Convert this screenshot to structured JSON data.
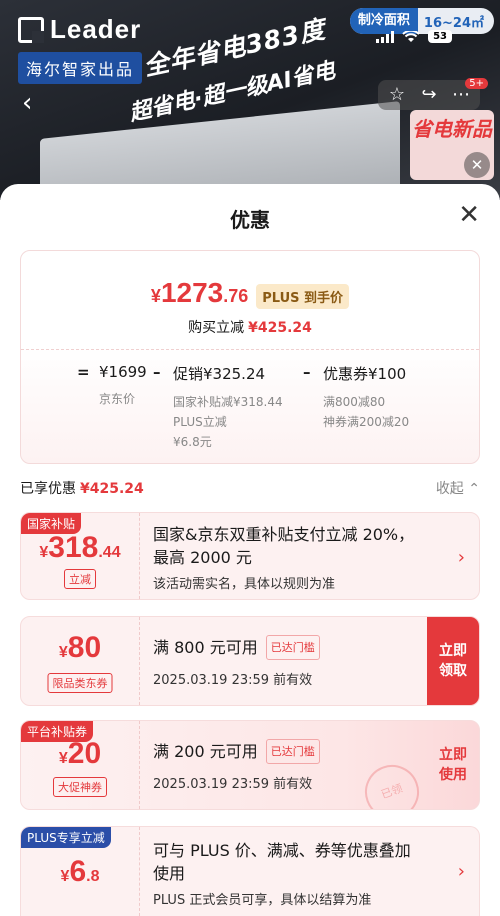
{
  "banner": {
    "logo": "Leader",
    "brand_tag": "海尔智家出品",
    "slogan_line1": "全年省电383度",
    "slogan_line2": "超省电·超一级AI省电",
    "area_chip_label": "制冷面积",
    "area_chip_value": "16~24㎡",
    "battery": "53",
    "new_badge_count": "5+",
    "side_card_text": "省电新品"
  },
  "sheet": {
    "title": "优惠"
  },
  "summary": {
    "currency": "¥",
    "price_int": "1273",
    "price_dec": ".76",
    "plus_tag": "PLUS 到手价",
    "direct_cut_label": "购买立减",
    "direct_cut_amount": "¥425.24",
    "breakdown": {
      "eq": "=",
      "jd_price": "¥1699",
      "jd_price_label": "京东价",
      "minus1": "–",
      "promo": "促销¥325.24",
      "promo_sub1": "国家补贴减¥318.44",
      "promo_sub2": "PLUS立减",
      "promo_sub3": "¥6.8元",
      "minus2": "–",
      "coupon": "优惠券¥100",
      "coupon_sub1": "满800减80",
      "coupon_sub2": "神券满200减20"
    }
  },
  "enjoyed": {
    "label": "已享优惠",
    "amount": "¥425.24",
    "collapse": "收起"
  },
  "cards": [
    {
      "tag": "国家补贴",
      "tag_color": "#e4393c",
      "cur": "¥",
      "int": "318",
      "dec": ".44",
      "sub": "立减",
      "title": "国家&京东双重补贴支付立减 20%，",
      "title2": "最高 2000 元",
      "desc": "该活动需实名，具体以规则为准"
    },
    {
      "cur": "¥",
      "int": "80",
      "sub": "限品类东券",
      "title": "满 800 元可用",
      "threshold": "已达门槛",
      "desc": "2025.03.19 23:59 前有效",
      "action": "立即领取",
      "action1": "立即",
      "action2": "领取",
      "action_bg": "#e4393c"
    },
    {
      "tag": "平台补贴券",
      "tag_color": "#e4393c",
      "cur": "¥",
      "int": "20",
      "sub": "大促神券",
      "title": "满 200 元可用",
      "threshold": "已达门槛",
      "desc": "2025.03.19 23:59 前有效",
      "action1": "立即",
      "action2": "使用",
      "stamp": "已领"
    },
    {
      "tag": "PLUS专享立减",
      "tag_color": "#2b4ea8",
      "cur": "¥",
      "int": "6",
      "dec": ".8",
      "title": "可与 PLUS 价、满减、券等优惠叠加",
      "title2": "使用",
      "desc": "PLUS 正式会员可享，具体以结算为准"
    }
  ]
}
